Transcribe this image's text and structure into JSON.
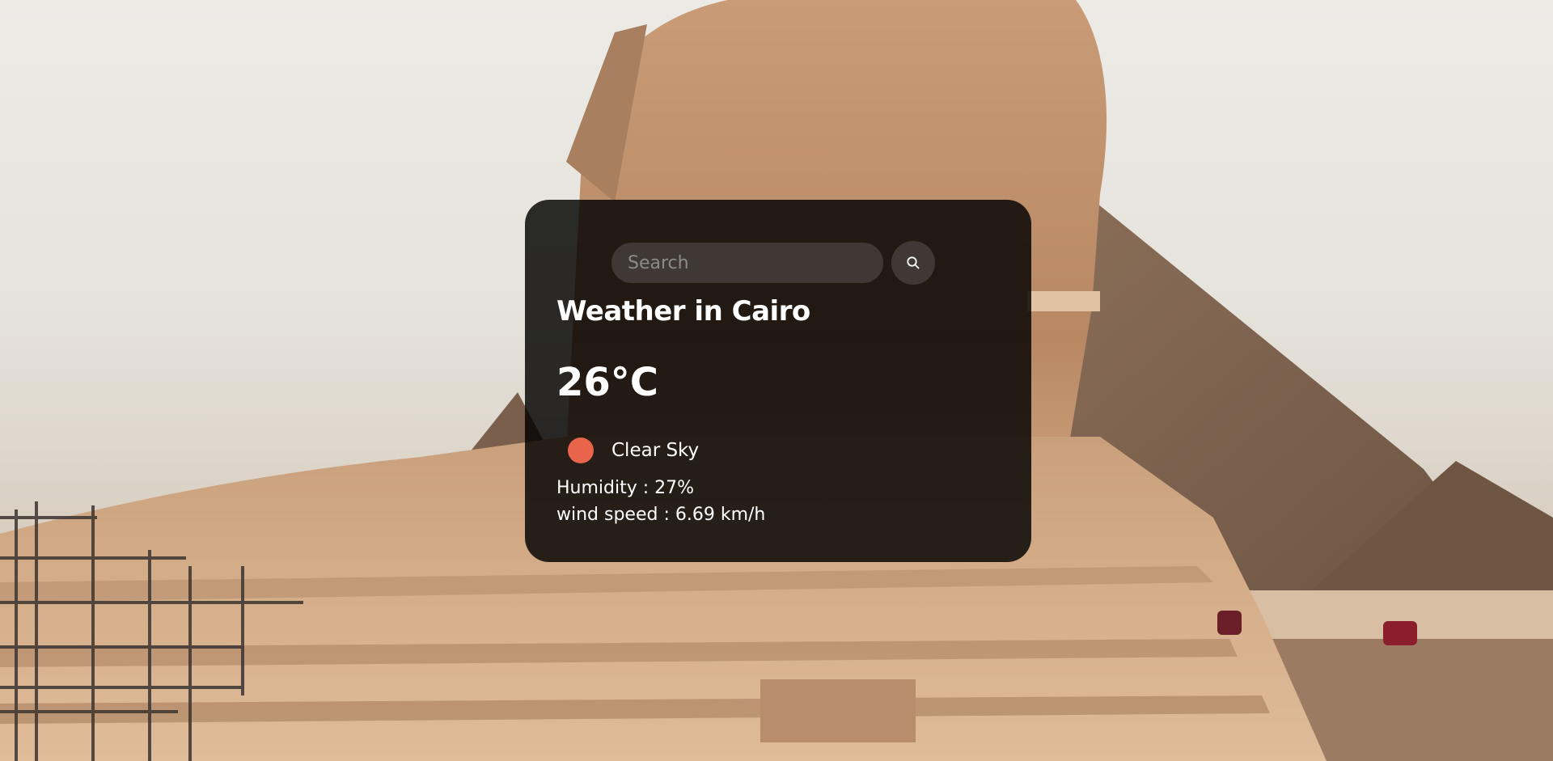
{
  "search": {
    "placeholder": "Search"
  },
  "weather": {
    "title": "Weather in Cairo",
    "temperature": "26°C",
    "description": "Clear Sky",
    "humidity": "Humidity : 27%",
    "wind": "wind speed : 6.69 km/h"
  },
  "colors": {
    "card_background": "#000000",
    "weather_icon": "#e8644a",
    "text": "#ffffff"
  },
  "icons": {
    "search_button": "search-icon",
    "weather": "clear-sky-icon"
  }
}
